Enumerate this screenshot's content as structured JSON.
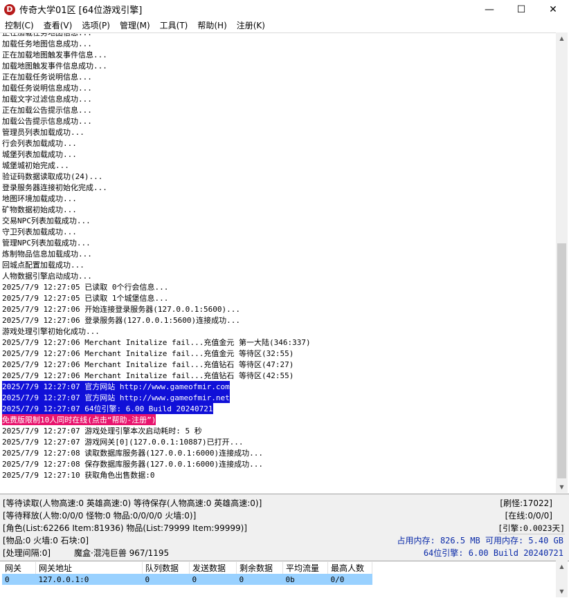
{
  "window": {
    "title": "传奇大学01区 [64位游戏引擎]",
    "icon_letter": "D",
    "minimize": "—",
    "maximize": "☐",
    "close": "✕"
  },
  "menu": [
    "控制(C)",
    "查看(V)",
    "选项(P)",
    "管理(M)",
    "工具(T)",
    "帮助(H)",
    "注册(K)"
  ],
  "log": [
    {
      "text": "正在加载任务地图信息...",
      "style": ""
    },
    {
      "text": "加载任务地图信息成功...",
      "style": ""
    },
    {
      "text": "正在加载地图触发事件信息...",
      "style": ""
    },
    {
      "text": "加载地图触发事件信息成功...",
      "style": ""
    },
    {
      "text": "正在加载任务说明信息...",
      "style": ""
    },
    {
      "text": "加载任务说明信息成功...",
      "style": ""
    },
    {
      "text": "加载文字过滤信息成功...",
      "style": ""
    },
    {
      "text": "正在加载公告提示信息...",
      "style": ""
    },
    {
      "text": "加载公告提示信息成功...",
      "style": ""
    },
    {
      "text": "管理员列表加载成功...",
      "style": ""
    },
    {
      "text": "行会列表加载成功...",
      "style": ""
    },
    {
      "text": "城堡列表加载成功...",
      "style": ""
    },
    {
      "text": "城堡城初始完成...",
      "style": ""
    },
    {
      "text": "验证码数据读取成功(24)...",
      "style": ""
    },
    {
      "text": "登录服务器连接初始化完成...",
      "style": ""
    },
    {
      "text": "地图环境加载成功...",
      "style": ""
    },
    {
      "text": "矿物数据初始成功...",
      "style": ""
    },
    {
      "text": "交易NPC列表加载成功...",
      "style": ""
    },
    {
      "text": "守卫列表加载成功...",
      "style": ""
    },
    {
      "text": "管理NPC列表加载成功...",
      "style": ""
    },
    {
      "text": "炼制物品信息加载成功...",
      "style": ""
    },
    {
      "text": "回城点配置加载成功...",
      "style": ""
    },
    {
      "text": "人物数据引擎启动成功...",
      "style": ""
    },
    {
      "text": "2025/7/9 12:27:05 已读取 0个行会信息...",
      "style": ""
    },
    {
      "text": "2025/7/9 12:27:05 已读取 1个城堡信息...",
      "style": ""
    },
    {
      "text": "2025/7/9 12:27:06 开始连接登录服务器(127.0.0.1:5600)...",
      "style": ""
    },
    {
      "text": "2025/7/9 12:27:06 登录服务器(127.0.0.1:5600)连接成功...",
      "style": ""
    },
    {
      "text": "游戏处理引擎初始化成功...",
      "style": ""
    },
    {
      "text": "2025/7/9 12:27:06 Merchant Initalize fail...充值金元 第一大陆(346:337)",
      "style": ""
    },
    {
      "text": "2025/7/9 12:27:06 Merchant Initalize fail...充值金元 等待区(32:55)",
      "style": ""
    },
    {
      "text": "2025/7/9 12:27:06 Merchant Initalize fail...充值钻石 等待区(47:27)",
      "style": ""
    },
    {
      "text": "2025/7/9 12:27:06 Merchant Initalize fail...充值钻石 等待区(42:55)",
      "style": ""
    },
    {
      "text": "2025/7/9 12:27:07 官方网站 http://www.gameofmir.com",
      "style": "hl-blue"
    },
    {
      "text": "2025/7/9 12:27:07 官方网站 http://www.gameofmir.net",
      "style": "hl-blue"
    },
    {
      "text": "2025/7/9 12:27:07 64位引擎: 6.00 Build 20240721",
      "style": "hl-blue"
    },
    {
      "text": "免费版限制10人同时在线(点击“帮助-注册”)",
      "style": "hl-pink"
    },
    {
      "text": "2025/7/9 12:27:07 游戏处理引擎本次启动耗时: 5 秒",
      "style": ""
    },
    {
      "text": "2025/7/9 12:27:07 游戏网关[0](127.0.0.1:10887)已打开...",
      "style": ""
    },
    {
      "text": "2025/7/9 12:27:08 读取数据库服务器(127.0.0.1:6000)连接成功...",
      "style": ""
    },
    {
      "text": "2025/7/9 12:27:08 保存数据库服务器(127.0.0.1:6000)连接成功...",
      "style": ""
    },
    {
      "text": "2025/7/9 12:27:10 获取角色出售数据:0",
      "style": ""
    }
  ],
  "status": {
    "wait_read": "[等待读取(人物高速:0 英雄高速:0) 等待保存(人物高速:0 英雄高速:0)]",
    "wait_release": "[等待释放(人物:0/0/0 怪物:0 物品:0/0/0/0 火墙:0)]",
    "role_list": "[角色(List:62266 Item:81936) 物品(List:79999 Item:99999)]",
    "items": "[物品:0 火墙:0 石块:0]",
    "interval": "[处理间隔:0]",
    "boss": "魔盒·混沌巨兽 967/1195",
    "refresh": "[刷怪:17022]",
    "online": "[在线:0/0/0]",
    "engine_time": "[引擎:0.0023天]",
    "memory": "占用内存: 826.5 MB 可用内存: 5.40 GB",
    "engine_version": "64位引擎: 6.00 Build 20240721"
  },
  "gateway": {
    "headers": [
      "网关",
      "网关地址",
      "队列数据",
      "发送数据",
      "剩余数据",
      "平均流量",
      "最高人数"
    ],
    "rows": [
      [
        "0",
        "127.0.0.1:0",
        "0",
        "0",
        "0",
        "0b",
        "0/0"
      ]
    ]
  },
  "colors": {
    "highlight_blue": "#1010d8",
    "highlight_pink": "#e8156e",
    "status_blue": "#0a2aa8",
    "row_selected": "#99d1ff"
  },
  "icons": {
    "app": "d-letter-icon",
    "scroll_up": "arrow-up-icon",
    "scroll_down": "arrow-down-icon"
  }
}
